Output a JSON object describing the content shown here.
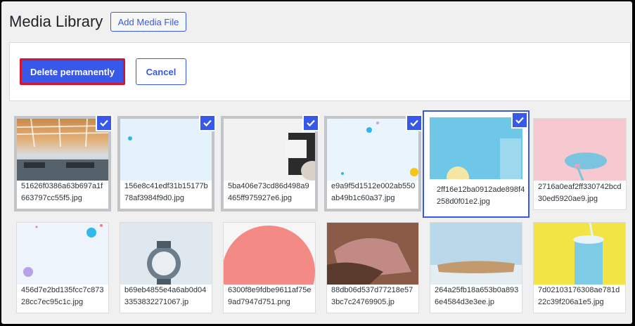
{
  "header": {
    "title": "Media Library",
    "add_label": "Add Media File"
  },
  "toolbar": {
    "delete_label": "Delete permanently",
    "cancel_label": "Cancel"
  },
  "items": [
    {
      "name": "51626f0386a63b697a1f663797cc55f5.jpg",
      "selected": true
    },
    {
      "name": "156e8c41edf31b15177b78af3984f9d0.jpg",
      "selected": true
    },
    {
      "name": "5ba406e73cd86d498a9465ff975927e6.jpg",
      "selected": true
    },
    {
      "name": "e9a9f5d1512e002ab550ab49b1c60a37.jpg",
      "selected": true
    },
    {
      "name": "2ff16e12ba0912ade898f4258d0f01e2.jpg",
      "selected": true
    },
    {
      "name": "2716a0eaf2ff330742bcd30ed5920ae9.jpg",
      "selected": false
    },
    {
      "name": "456d7e2bd135fcc7c87328cc7ec95c1c.jpg",
      "selected": false
    },
    {
      "name": "b69eb4855e4a6ab0d043353832271067.jp",
      "selected": false
    },
    {
      "name": "6300f8e9fdbe9611af75e9ad7947d751.png",
      "selected": false
    },
    {
      "name": "88db06d537d77218e573bc7c24769905.jp",
      "selected": false
    },
    {
      "name": "264a25fb18a653b0a8936e4584d3e3ee.jp",
      "selected": false
    },
    {
      "name": "7d02103176308ae781d22c39f206a1e5.jpg",
      "selected": false
    }
  ],
  "colors": {
    "accent": "#3858e9",
    "danger_outline": "#d6142b",
    "background": "#f0f0f1"
  }
}
